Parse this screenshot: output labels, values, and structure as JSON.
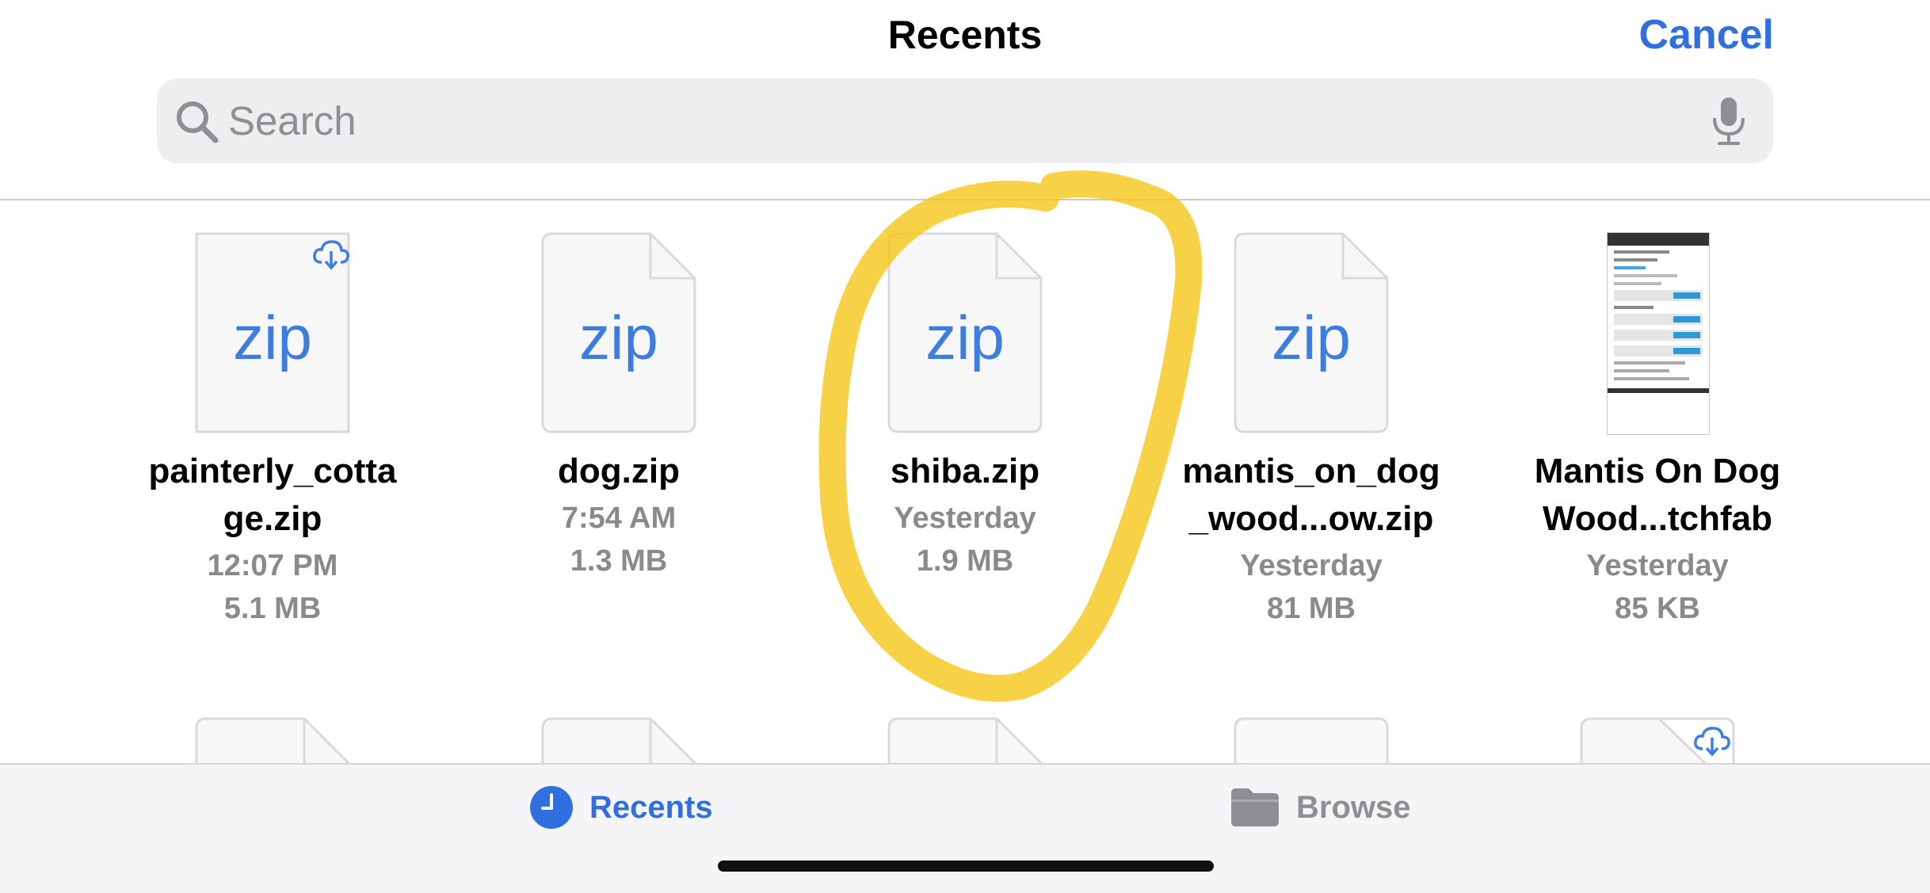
{
  "header": {
    "title": "Recents",
    "cancel_label": "Cancel"
  },
  "search": {
    "placeholder": "Search"
  },
  "files": [
    {
      "name": "painterly_cotta\nge.zip",
      "time": "12:07 PM",
      "size": "5.1 MB",
      "type_label": "zip",
      "cloud": true
    },
    {
      "name": "dog.zip",
      "time": "7:54 AM",
      "size": "1.3 MB",
      "type_label": "zip",
      "cloud": false
    },
    {
      "name": "shiba.zip",
      "time": "Yesterday",
      "size": "1.9 MB",
      "type_label": "zip",
      "cloud": false,
      "highlighted": true
    },
    {
      "name": "mantis_on_dog\n_wood...ow.zip",
      "time": "Yesterday",
      "size": "81 MB",
      "type_label": "zip",
      "cloud": false
    },
    {
      "name": "Mantis On Dog\nWood...tchfab",
      "time": "Yesterday",
      "size": "85 KB",
      "type_label": "",
      "thumbnail": "webpage-screenshot"
    }
  ],
  "tabbar": {
    "recents_label": "Recents",
    "browse_label": "Browse"
  },
  "colors": {
    "accent": "#2f6fe0",
    "zip_text": "#3b7de0",
    "highlight": "#f5c518",
    "secondary_text": "#8a8a8e"
  }
}
